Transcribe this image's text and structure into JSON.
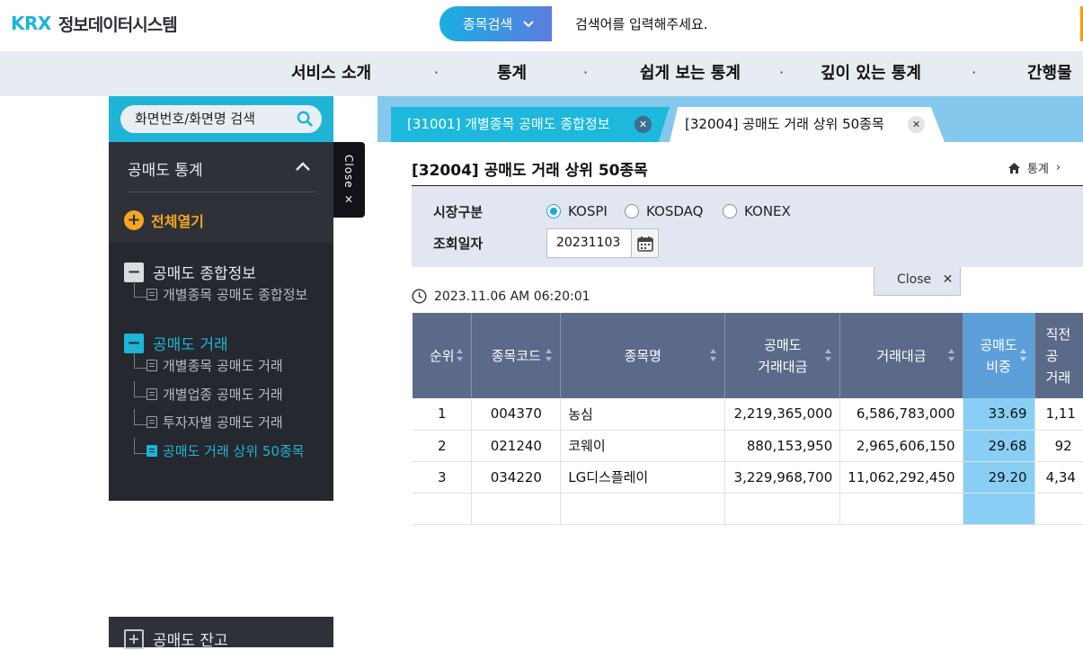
{
  "header": {
    "logo_mark": "KRX",
    "logo_text": "정보데이터시스템",
    "search_type": "종목검색",
    "search_placeholder": "검색어를 입력해주세요."
  },
  "gnb": {
    "items": [
      "서비스 소개",
      "통계",
      "쉽게 보는 통계",
      "깊이 있는 통계",
      "간행물"
    ],
    "separator": "·"
  },
  "sidebar": {
    "search_placeholder": "화면번호/화면명 검색",
    "section_title": "공매도 통계",
    "open_all": "전체열기",
    "groups": [
      {
        "label": "공매도 종합정보",
        "items": [
          "개별종목 공매도 종합정보"
        ]
      },
      {
        "label": "공매도 거래",
        "items": [
          "개별종목 공매도 거래",
          "개별업종 공매도 거래",
          "투자자별 공매도 거래",
          "공매도 거래 상위 50종목"
        ]
      },
      {
        "label": "공매도 잔고",
        "items": []
      }
    ],
    "close_label": "Close ×"
  },
  "tabs": [
    {
      "label": "[31001] 개별종목 공매도 종합정보",
      "active": false
    },
    {
      "label": "[32004] 공매도 거래 상위 50종목",
      "active": true
    }
  ],
  "page": {
    "title": "[32004] 공매도 거래 상위 50종목",
    "breadcrumb": "통계",
    "breadcrumb_sep": "›"
  },
  "filter": {
    "market_label": "시장구분",
    "market_options": [
      "KOSPI",
      "KOSDAQ",
      "KONEX"
    ],
    "market_selected": "KOSPI",
    "date_label": "조회일자",
    "date_value": "20231103",
    "close_label": "Close"
  },
  "timestamp": "2023.11.06 AM 06:20:01",
  "table": {
    "headers": [
      "순위",
      "종목코드",
      "종목명",
      "공매도\n거래대금",
      "거래대금",
      "공매도\n비중",
      "직전\n공\n거래"
    ],
    "rows": [
      [
        "1",
        "004370",
        "농심",
        "2,219,365,000",
        "6,586,783,000",
        "33.69",
        "1,11"
      ],
      [
        "2",
        "021240",
        "코웨이",
        "880,153,950",
        "2,965,606,150",
        "29.68",
        "92"
      ],
      [
        "3",
        "034220",
        "LG디스플레이",
        "3,229,968,700",
        "11,062,292,450",
        "29.20",
        "4,34"
      ],
      [
        "",
        "",
        "",
        "",
        "",
        "",
        ""
      ]
    ]
  },
  "colors": {
    "accent": "#1eb4d8",
    "sidebar_bg": "#2e3138",
    "table_header": "#5b6a89",
    "highlight_col": "#89cff5",
    "orange": "#f5a623"
  }
}
